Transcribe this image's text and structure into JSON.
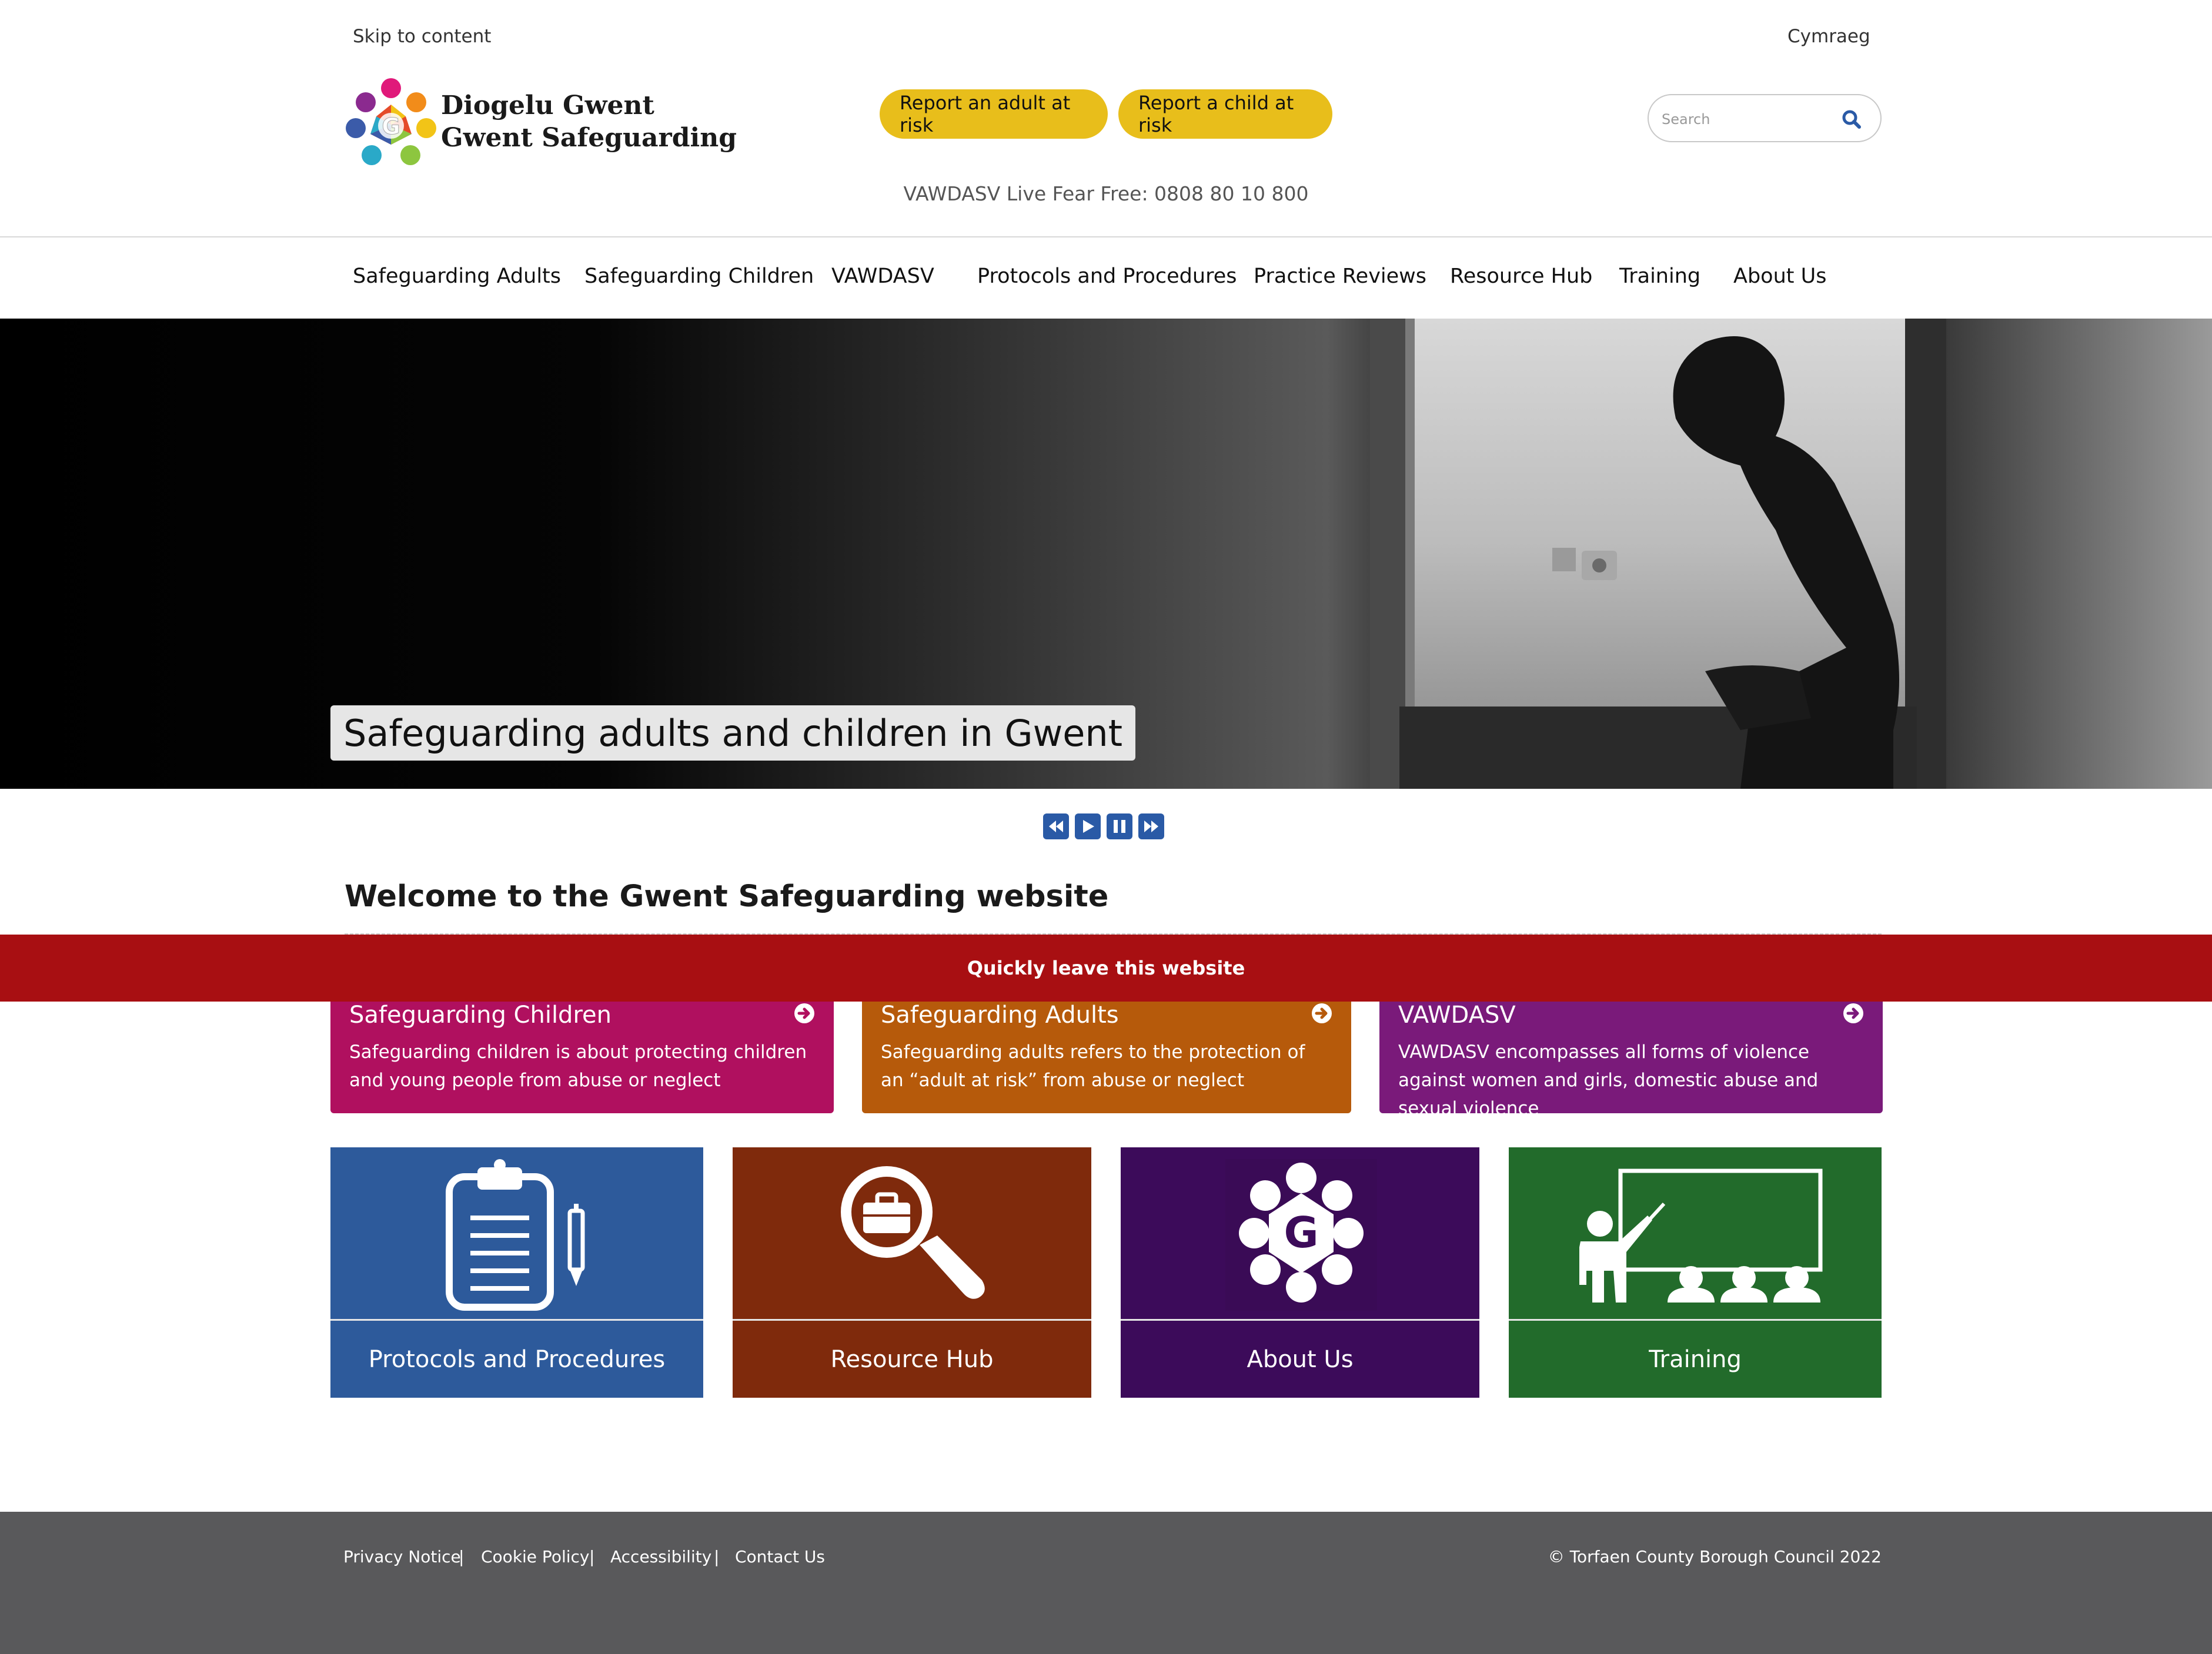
{
  "header": {
    "skip_link": "Skip to content",
    "language_link": "Cymraeg",
    "logo_line1": "Diogelu Gwent",
    "logo_line2": "Gwent Safeguarding",
    "report_adult": "Report an adult at risk",
    "report_child": "Report a child at risk",
    "search_placeholder": "Search",
    "hotline": "VAWDASV Live Fear Free: 0808 80 10 800"
  },
  "nav": {
    "items": [
      "Safeguarding Adults",
      "Safeguarding Children",
      "VAWDASV",
      "Protocols and Procedures",
      "Practice Reviews",
      "Resource Hub",
      "Training",
      "About Us"
    ]
  },
  "hero": {
    "caption": "Safeguarding adults and children in Gwent"
  },
  "slider_controls": [
    "previous-icon",
    "play-icon",
    "pause-icon",
    "next-icon"
  ],
  "welcome": {
    "title": "Welcome to the Gwent Safeguarding website"
  },
  "quick_leave": "Quickly leave this website",
  "cards": [
    {
      "title": "Safeguarding Children",
      "desc": "Safeguarding children is about protecting children and young people from abuse or neglect",
      "color": "#b0105f"
    },
    {
      "title": "Safeguarding Adults",
      "desc": "Safeguarding adults refers to the protection of an “adult at risk” from abuse or neglect",
      "color": "#b65a0b"
    },
    {
      "title": "VAWDASV",
      "desc": "VAWDASV encompasses all forms of violence against women and girls, domestic abuse and sexual violence",
      "color": "#7a1a7a"
    }
  ],
  "tiles": [
    {
      "label": "Protocols and Procedures",
      "icon": "clipboard-icon",
      "color": "#2d5a9b"
    },
    {
      "label": "Resource Hub",
      "icon": "magnifier-briefcase-icon",
      "color": "#7f2a0c"
    },
    {
      "label": "About Us",
      "icon": "gwent-g-logo-icon",
      "color": "#3c0b5a"
    },
    {
      "label": "Training",
      "icon": "teacher-class-icon",
      "color": "#226b2b"
    }
  ],
  "footer": {
    "links": [
      "Privacy Notice",
      "Cookie Policy",
      "Accessibility",
      "Contact Us"
    ],
    "separator": "|",
    "copyright": "© Torfaen County Borough Council 2022"
  },
  "colors": {
    "report_button": "#e8be1b",
    "quick_leave": "#a80f12",
    "footer": "#59595b",
    "slider_control": "#2a5aa6"
  }
}
